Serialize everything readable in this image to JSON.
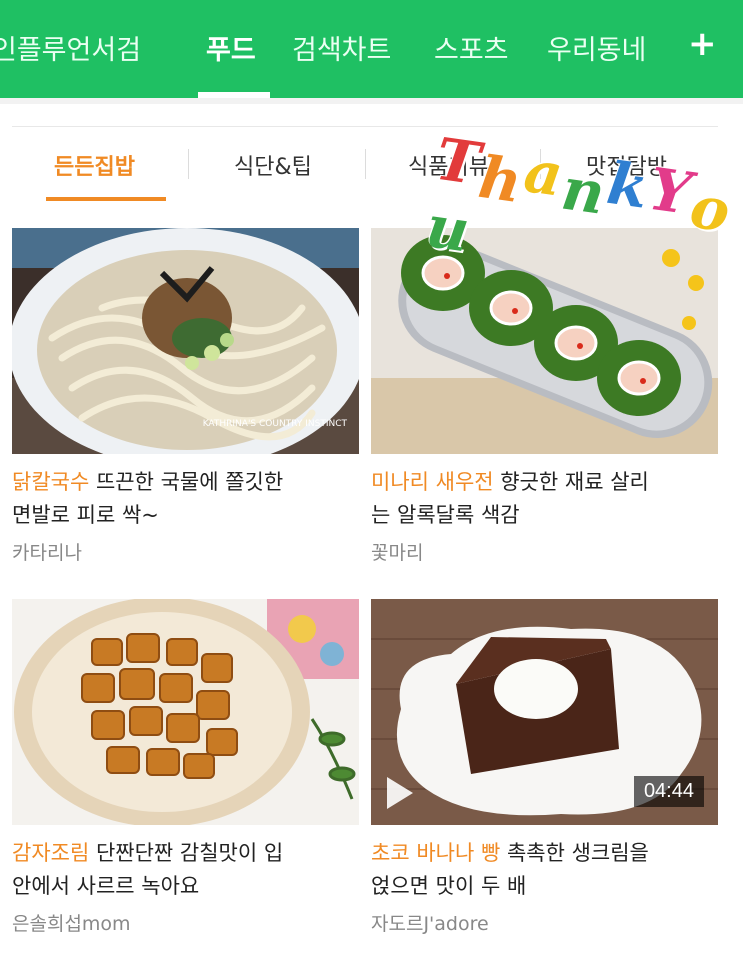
{
  "topnav": {
    "tabs": [
      {
        "label": "인플루언서검"
      },
      {
        "label": "푸드"
      },
      {
        "label": "검색차트"
      },
      {
        "label": "스포츠"
      },
      {
        "label": "우리동네"
      }
    ],
    "more_label": "+"
  },
  "subnav": {
    "tabs": [
      {
        "label": "든든집밥"
      },
      {
        "label": "식단&팁"
      },
      {
        "label": "식품리뷰"
      },
      {
        "label": "맛집탐방"
      }
    ]
  },
  "sticker": {
    "text": "Thank You"
  },
  "cards": [
    {
      "highlight": "닭칼국수",
      "line1": " 뜨끈한 국물에 쫄깃한",
      "line2": "면발로 피로 싹~",
      "author": "카타리나",
      "watermark": "KATHRINA'S COUNTRY INSTINCT"
    },
    {
      "highlight": "미나리 새우전",
      "line1": " 향긋한 재료 살리",
      "line2": "는 알록달록 색감",
      "author": "꽃마리"
    },
    {
      "highlight": "감자조림",
      "line1": " 단짠단짠 감칠맛이 입",
      "line2": "안에서 사르르 녹아요",
      "author": "은솔희섭mom"
    },
    {
      "highlight": "초코 바나나 빵",
      "line1": " 촉촉한 생크림을",
      "line2": "얹으면 맛이 두 배",
      "author": "자도르J'adore",
      "duration": "04:44"
    }
  ],
  "colors": {
    "brand_green": "#1fc063",
    "accent_orange": "#f08a24"
  },
  "icons": {
    "more": "plus-icon",
    "video": "play-icon"
  }
}
